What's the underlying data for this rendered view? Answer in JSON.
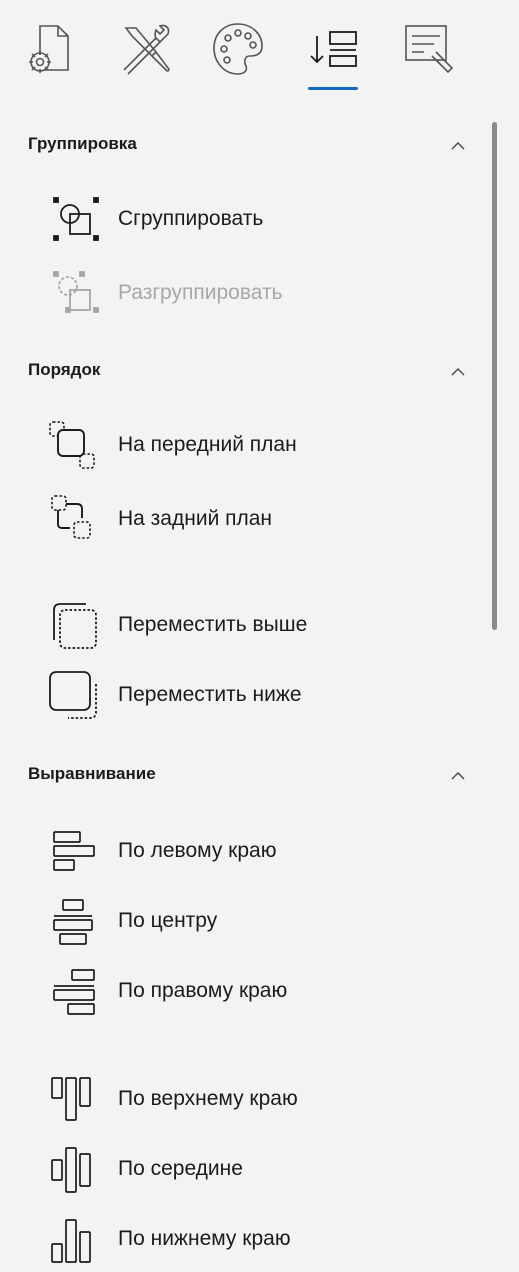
{
  "tabs": [
    {
      "name": "page-settings",
      "icon": "page-gear-icon"
    },
    {
      "name": "tools",
      "icon": "tools-icon"
    },
    {
      "name": "style",
      "icon": "palette-icon"
    },
    {
      "name": "arrange",
      "icon": "arrange-icon",
      "selected": true
    },
    {
      "name": "text",
      "icon": "text-edit-icon"
    }
  ],
  "colors": {
    "accent": "#0f6cbd",
    "disabled": "#a7a7a7",
    "background": "#f3f3f3"
  },
  "sections": {
    "group": {
      "title": "Группировка",
      "items": [
        "Сгруппировать",
        "Разгруппировать"
      ],
      "ungroup_disabled": true
    },
    "order": {
      "title": "Порядок",
      "items": [
        "На передний план",
        "На задний план",
        "Переместить выше",
        "Переместить ниже"
      ]
    },
    "align": {
      "title": "Выравнивание",
      "items": [
        "По левому краю",
        "По центру",
        "По правому краю",
        "По верхнему краю",
        "По середине",
        "По нижнему краю"
      ]
    }
  }
}
